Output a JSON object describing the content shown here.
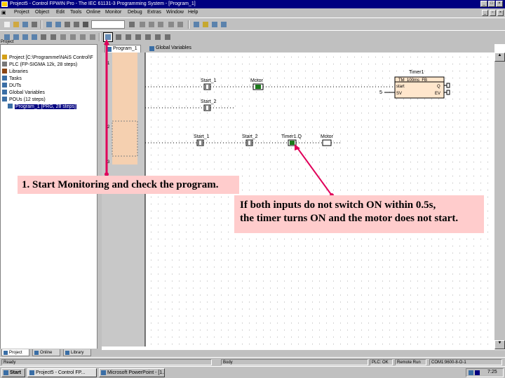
{
  "window": {
    "title": "Project5 - Control FPWIN Pro - The IEC 61131-3 Programming System - [Program_1]"
  },
  "menu": [
    "Project",
    "Object",
    "Edit",
    "Tools",
    "Online",
    "Monitor",
    "Debug",
    "Extras",
    "Window",
    "Help"
  ],
  "project_panel": {
    "caption": "Project",
    "items": [
      "Project [C:\\Programme\\NAiS Control\\F",
      "PLC (FP-SIGMA 12k, 28 steps)",
      "Libraries",
      "Tasks",
      "DUTs",
      "Global Variables",
      "POUs (12 steps)",
      "Program_1 [PRG, 28 steps]"
    ],
    "tabs": [
      "Project",
      "Online",
      "Library"
    ]
  },
  "editor": {
    "tabs": [
      "Program_1",
      "Global Variables"
    ],
    "rung1": {
      "contact1": "Start_1",
      "contact2": "Start_2",
      "output": "Motor",
      "timer_instance": "Timer1",
      "timer_type": "TM_100ms_FB",
      "timer_pins": [
        "start",
        "SV",
        "Q",
        "EV"
      ],
      "sv_value": "5"
    },
    "rung2": {
      "contact1": "Start_1",
      "contact2": "Start_2",
      "contact3": "Timer1.Q",
      "output": "Motor"
    }
  },
  "status_bar": [
    "Ready",
    "Body",
    "PLC: OK",
    "Remote Run",
    "COM1:9600-8-O-1"
  ],
  "taskbar": {
    "start": "Start",
    "buttons": [
      "Project5 - Control FP...",
      "Microsoft PowerPoint - [1..."
    ],
    "clock": "7:25"
  },
  "callouts": [
    "1. Start Monitoring and check the program.",
    "If both inputs do not switch ON within 0.5s,",
    "the timer turns ON and the motor does not start."
  ],
  "colors": {
    "callout_bg": "#ffcccc",
    "arrow": "#e0005a",
    "rung_highlight": "#f5d0b0",
    "contact_on": "#1a7a1a",
    "titlebar": "#000080"
  }
}
